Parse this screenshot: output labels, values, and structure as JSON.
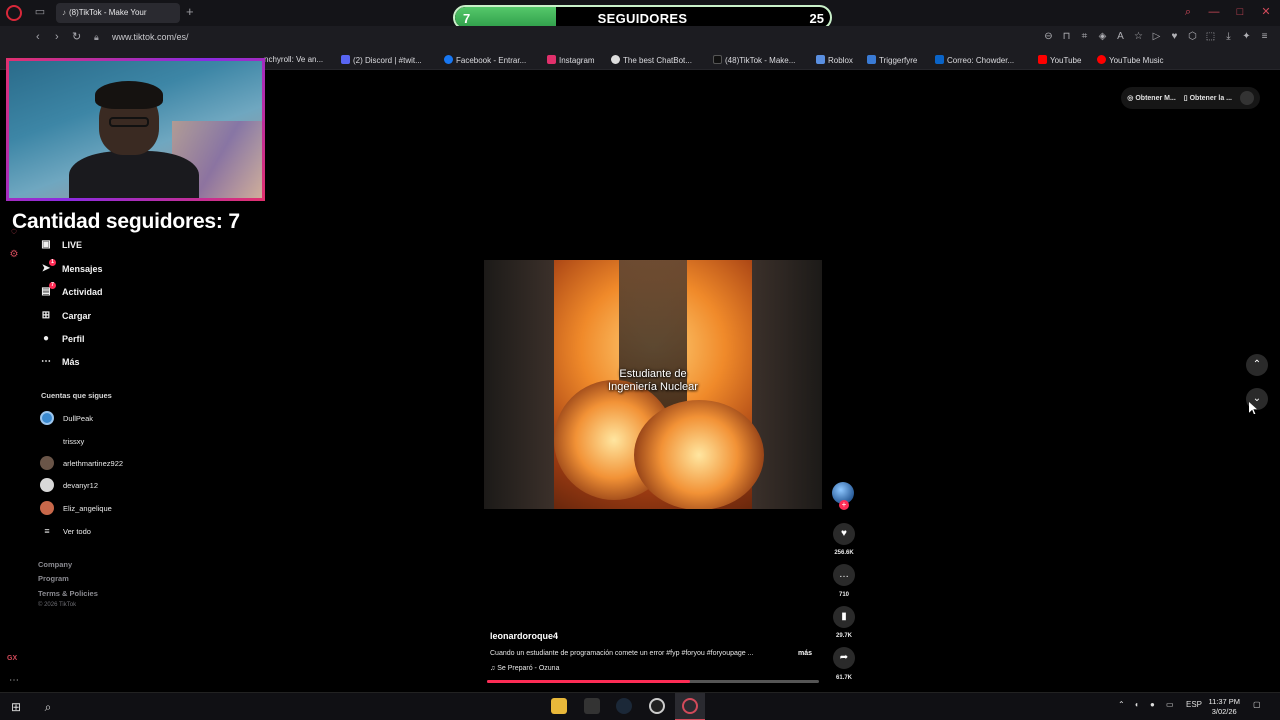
{
  "browser": {
    "active_tab_title": "(8)TikTok - Make Your",
    "url": "www.tiktok.com/es/",
    "bookmarks": [
      "nchyroll: Ve an...",
      "(2) Discord | #twit...",
      "Facebook - Entrar...",
      "Instagram",
      "The best ChatBot...",
      "(48)TikTok - Make...",
      "Roblox",
      "Triggerfyre",
      "Correo: Chowder...",
      "YouTube",
      "YouTube Music"
    ],
    "rail_label": "GX"
  },
  "follower_goal": {
    "current": "7",
    "title": "SEGUIDORES",
    "goal": "25",
    "fill_fraction": 0.27
  },
  "overlay": {
    "followers_text": "Cantidad seguidores: 7"
  },
  "sidebar": {
    "nav": [
      {
        "label": "LIVE",
        "icon": "live-icon"
      },
      {
        "label": "Mensajes",
        "icon": "messages-icon",
        "badge": "1"
      },
      {
        "label": "Actividad",
        "icon": "activity-icon",
        "badge": "7"
      },
      {
        "label": "Cargar",
        "icon": "upload-icon"
      },
      {
        "label": "Perfil",
        "icon": "profile-icon"
      },
      {
        "label": "Más",
        "icon": "more-icon"
      }
    ],
    "following_title": "Cuentas que sigues",
    "accounts": [
      "DullPeak",
      "trissxy",
      "arlethmartinez922",
      "devanyr12",
      "Eliz_angelique"
    ],
    "see_all": "Ver todo",
    "footer_links": [
      "Company",
      "Program",
      "Terms & Policies"
    ],
    "copyright": "© 2026 TikTok"
  },
  "top_right": {
    "btn1": "Obtener M...",
    "btn2": "Obtener la ..."
  },
  "video": {
    "caption_line1": "Estudiante de",
    "caption_line2": "Ingeniería Nuclear",
    "username": "leonardoroque4",
    "description": "Cuando un estudiante de programación comete un error #fyp #foryou #foryoupage ...",
    "more_label": "más",
    "music": "Se Preparó - Ozuna",
    "likes": "256.6K",
    "comments": "710",
    "saves": "29.7K",
    "shares": "61.7K",
    "progress_fraction": 0.61
  },
  "taskbar": {
    "language": "ESP",
    "time": "11:37 PM",
    "date": "3/02/26"
  }
}
